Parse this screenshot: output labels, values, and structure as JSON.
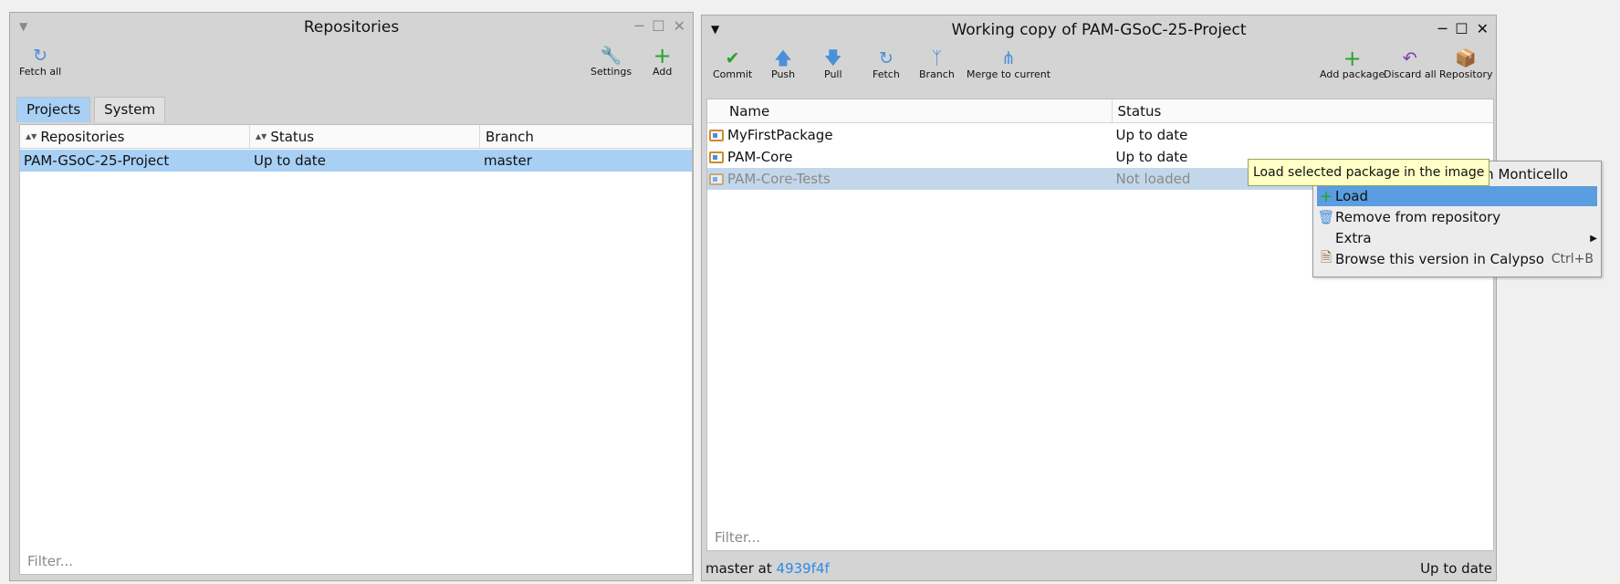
{
  "colors": {
    "window_bg": "#d4d4d4",
    "selection": "#a8d0f5",
    "menu_highlight": "#5a9de0",
    "tooltip_bg": "#ffffc6",
    "link": "#2b8be6",
    "green": "#2aa32a",
    "blue": "#4a90d9",
    "purple": "#7a3fb3"
  },
  "repos_window": {
    "title": "Repositories",
    "toolbar": {
      "fetch_all": "Fetch all",
      "settings": "Settings",
      "add": "Add"
    },
    "tabs": [
      "Projects",
      "System"
    ],
    "columns": [
      "Repositories",
      "Status",
      "Branch"
    ],
    "rows": [
      {
        "name": "PAM-GSoC-25-Project",
        "status": "Up to date",
        "branch": "master"
      }
    ],
    "filter_placeholder": "Filter..."
  },
  "wc_window": {
    "title": "Working copy of PAM-GSoC-25-Project",
    "toolbar": {
      "commit": "Commit",
      "push": "Push",
      "pull": "Pull",
      "fetch": "Fetch",
      "branch": "Branch",
      "merge": "Merge to current",
      "add_package": "Add package",
      "discard_all": "Discard all",
      "repository": "Repository"
    },
    "columns": [
      "Name",
      "Status"
    ],
    "rows": [
      {
        "name": "MyFirstPackage",
        "status": "Up to date"
      },
      {
        "name": "PAM-Core",
        "status": "Up to date"
      },
      {
        "name": "PAM-Core-Tests",
        "status": "Not loaded"
      }
    ],
    "filter_placeholder": "Filter...",
    "status_bar": {
      "branch_prefix": "master at",
      "commit": "4939f4f",
      "state": "Up to date"
    }
  },
  "context_menu": {
    "obscured_item_suffix": "in Monticello",
    "items": [
      {
        "label": "Load",
        "icon": "plus-icon"
      },
      {
        "label": "Remove from repository",
        "icon": "trash-icon"
      },
      {
        "label": "Extra",
        "icon": "submenu-arrow-icon"
      },
      {
        "label": "Browse this version in Calypso",
        "icon": "document-icon",
        "shortcut": "Ctrl+B"
      }
    ]
  },
  "tooltip": "Load selected package in the image"
}
